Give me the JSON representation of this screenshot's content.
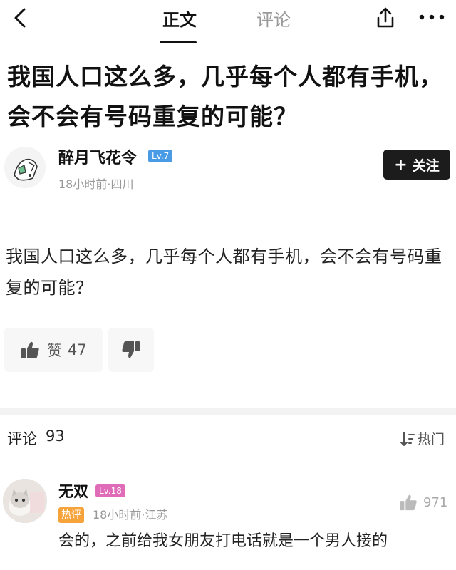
{
  "nav": {
    "tab_body": "正文",
    "tab_comments": "评论",
    "back_icon": "chevron-left-icon",
    "share_icon": "share-icon",
    "more_icon": "more-horizontal-icon"
  },
  "article": {
    "title": "我国人口这么多，几乎每个人都有手机，会不会有号码重复的可能？",
    "body": "我国人口这么多，几乎每个人都有手机，会不会有号码重复的可能？"
  },
  "author": {
    "name": "醉月飞花令",
    "level": "Lv.7",
    "meta": "18小时前·四川",
    "follow_label": "关注",
    "badge_color": "#4a9be6"
  },
  "reactions": {
    "like_label": "赞",
    "like_count": "47",
    "like_icon": "thumbs-up-icon",
    "dislike_icon": "thumbs-down-icon"
  },
  "comments": {
    "label": "评论",
    "count": "93",
    "sort_label": "热门",
    "sort_icon": "sort-icon",
    "items": [
      {
        "user": "无双",
        "level": "Lv.18",
        "tag": "热评",
        "meta": "18小时前·江苏",
        "likes": "971",
        "text": "会的，之前给我女朋友打电话就是一个男人接的",
        "level_color": "#e06bb8",
        "tag_color": "#f6a33b"
      }
    ]
  }
}
